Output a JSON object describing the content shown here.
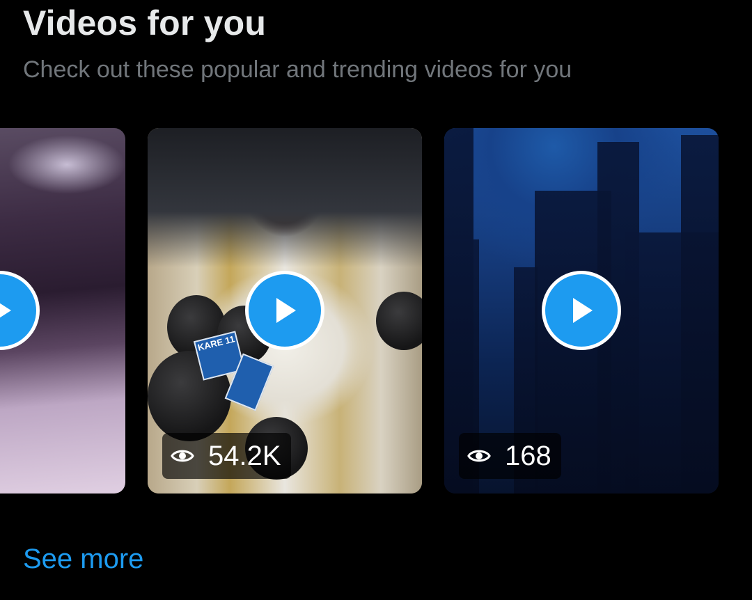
{
  "section": {
    "title": "Videos for you",
    "subtitle": "Check out these popular and trending videos for you"
  },
  "videos": [
    {
      "views": null,
      "icon": "play-icon"
    },
    {
      "views": "54.2K",
      "icon": "play-icon",
      "overlay_text": "KARE 11"
    },
    {
      "views": "168",
      "icon": "play-icon"
    }
  ],
  "footer": {
    "see_more_label": "See more"
  },
  "colors": {
    "background": "#000000",
    "title": "#e7e9ea",
    "subtitle": "#71767b",
    "accent": "#1d9bf0"
  }
}
